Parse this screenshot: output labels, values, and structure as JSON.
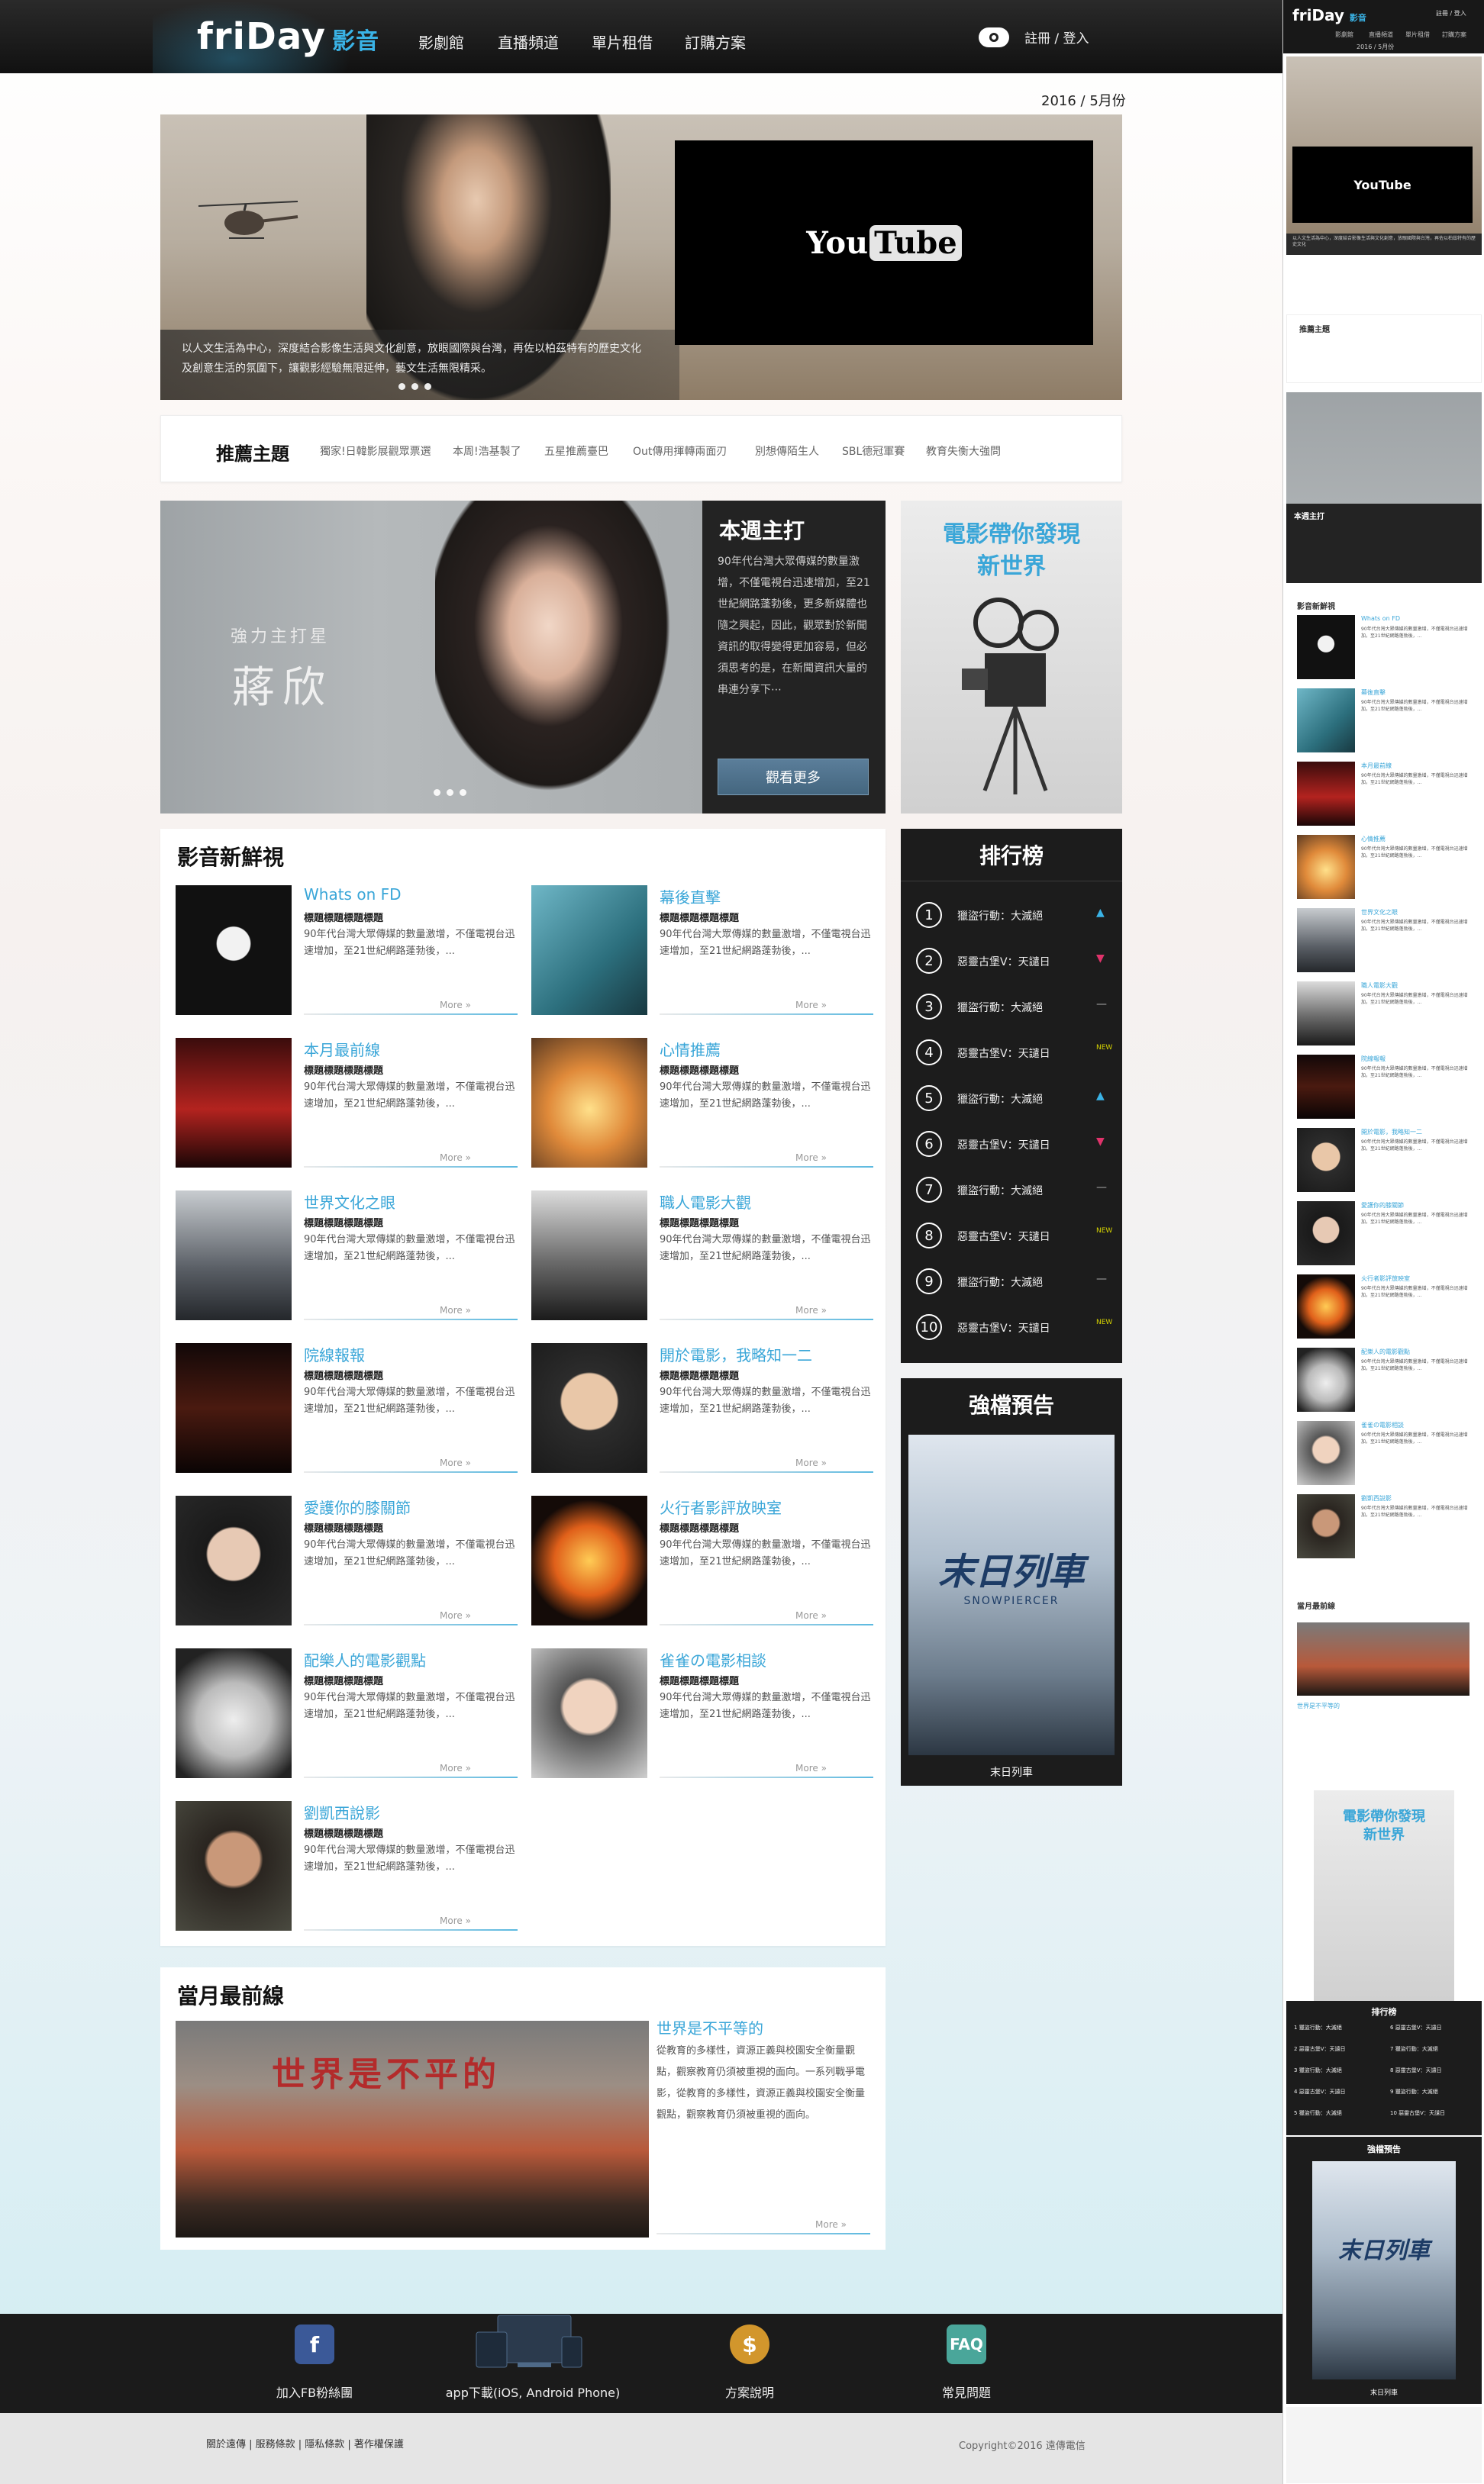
{
  "header": {
    "logo": "friDay",
    "logo_sub": "影音",
    "nav": [
      "影劇館",
      "直播頻道",
      "單片租借",
      "訂購方案"
    ],
    "register": "註冊",
    "slash": "/",
    "login": "登入"
  },
  "date": "2016 / 5月份",
  "hero": {
    "caption_line1": "以人文生活為中心，深度結合影像生活與文化創意，放眼國際與台灣，再佐以柏茲特有的歷史文化",
    "caption_line2": "及創意生活的氛圍下，讓觀影經驗無限延伸，藝文生活無限精采。",
    "video_logo_a": "You",
    "video_logo_b": "Tube"
  },
  "topics": {
    "title": "推薦主題",
    "items": [
      "獨家!日韓影展觀眾票選",
      "本周!浩基製了",
      "五星推薦臺巴",
      "Out傳用揮轉兩面刃",
      "別想傳陌生人",
      "SBL德冠軍賽",
      "教育失衡大強問"
    ]
  },
  "feature": {
    "tagline": "強力主打星",
    "name": "蔣欣"
  },
  "weekly": {
    "title": "本週主打",
    "body": "90年代台灣大眾傳媒的數量激增，不僅電視台迅速增加，至21世紀網路蓬勃後，更多新媒體也隨之興起，因此，觀眾對於新聞資訊的取得變得更加容易，但必須思考的是，在新聞資訊大量的串連分享下⋯",
    "button": "觀看更多"
  },
  "movie_promo": {
    "line1": "電影帶你發現",
    "line2": "新世界"
  },
  "news": {
    "title": "影音新鮮視",
    "items": [
      {
        "title": "Whats on FD",
        "subtitle": "標題標題標題標題",
        "desc": "90年代台灣大眾傳媒的數量激增，不僅電視台迅速增加，至21世紀網路蓬勃後，...",
        "more": "More »"
      },
      {
        "title": "幕後直擊",
        "subtitle": "標題標題標題標題",
        "desc": "90年代台灣大眾傳媒的數量激增，不僅電視台迅速增加，至21世紀網路蓬勃後，...",
        "more": "More »"
      },
      {
        "title": "本月最前線",
        "subtitle": "標題標題標題標題",
        "desc": "90年代台灣大眾傳媒的數量激增，不僅電視台迅速增加，至21世紀網路蓬勃後，...",
        "more": "More »"
      },
      {
        "title": "心情推薦",
        "subtitle": "標題標題標題標題",
        "desc": "90年代台灣大眾傳媒的數量激增，不僅電視台迅速增加，至21世紀網路蓬勃後，...",
        "more": "More »"
      },
      {
        "title": "世界文化之眼",
        "subtitle": "標題標題標題標題",
        "desc": "90年代台灣大眾傳媒的數量激增，不僅電視台迅速增加，至21世紀網路蓬勃後，...",
        "more": "More »"
      },
      {
        "title": "職人電影大觀",
        "subtitle": "標題標題標題標題",
        "desc": "90年代台灣大眾傳媒的數量激增，不僅電視台迅速增加，至21世紀網路蓬勃後，...",
        "more": "More »"
      },
      {
        "title": "院線報報",
        "subtitle": "標題標題標題標題",
        "desc": "90年代台灣大眾傳媒的數量激增，不僅電視台迅速增加，至21世紀網路蓬勃後，...",
        "more": "More »"
      },
      {
        "title": "開於電影，我略知一二",
        "subtitle": "標題標題標題標題",
        "desc": "90年代台灣大眾傳媒的數量激增，不僅電視台迅速增加，至21世紀網路蓬勃後，...",
        "more": "More »"
      },
      {
        "title": "愛護你的膝關節",
        "subtitle": "標題標題標題標題",
        "desc": "90年代台灣大眾傳媒的數量激增，不僅電視台迅速增加，至21世紀網路蓬勃後，...",
        "more": "More »"
      },
      {
        "title": "火行者影評放映室",
        "subtitle": "標題標題標題標題",
        "desc": "90年代台灣大眾傳媒的數量激增，不僅電視台迅速增加，至21世紀網路蓬勃後，...",
        "more": "More »"
      },
      {
        "title": "配樂人的電影觀點",
        "subtitle": "標題標題標題標題",
        "desc": "90年代台灣大眾傳媒的數量激增，不僅電視台迅速增加，至21世紀網路蓬勃後，...",
        "more": "More »"
      },
      {
        "title": "雀雀の電影相談",
        "subtitle": "標題標題標題標題",
        "desc": "90年代台灣大眾傳媒的數量激增，不僅電視台迅速增加，至21世紀網路蓬勃後，...",
        "more": "More »"
      },
      {
        "title": "劉凱西說影",
        "subtitle": "標題標題標題標題",
        "desc": "90年代台灣大眾傳媒的數量激增，不僅電視台迅速增加，至21世紀網路蓬勃後，...",
        "more": "More »"
      }
    ]
  },
  "ranking": {
    "title": "排行榜",
    "rows": [
      {
        "n": "1",
        "title": "獵盜行動：大滅絕",
        "trend": "▲"
      },
      {
        "n": "2",
        "title": "惡靈古堡V：天譴日",
        "trend": "▼"
      },
      {
        "n": "3",
        "title": "獵盜行動：大滅絕",
        "trend": "—"
      },
      {
        "n": "4",
        "title": "惡靈古堡V：天譴日",
        "trend": "NEW"
      },
      {
        "n": "5",
        "title": "獵盜行動：大滅絕",
        "trend": "▲"
      },
      {
        "n": "6",
        "title": "惡靈古堡V：天譴日",
        "trend": "▼"
      },
      {
        "n": "7",
        "title": "獵盜行動：大滅絕",
        "trend": "—"
      },
      {
        "n": "8",
        "title": "惡靈古堡V：天譴日",
        "trend": "NEW"
      },
      {
        "n": "9",
        "title": "獵盜行動：大滅絕",
        "trend": "—"
      },
      {
        "n": "10",
        "title": "惡靈古堡V：天譴日",
        "trend": "NEW"
      }
    ],
    "colors": {
      "up": "#3ab3e6",
      "down": "#e0336b",
      "new": "#d7d400"
    }
  },
  "trailer": {
    "title": "強檔預告",
    "poster_title": "末日列車",
    "poster_sub": "SNOWPIERCER",
    "caption": "末日列車"
  },
  "front": {
    "title": "當月最前線",
    "img_text": "世界是不平的",
    "item_title": "世界是不平等的",
    "desc": "從教育的多樣性，資源正義與校園安全衡量觀點，觀察教育仍須被重視的面向。一系列戰爭電影，從教育的多樣性，資源正義與校園安全衡量觀點，觀察教育仍須被重視的面向。",
    "more": "More »"
  },
  "footer": {
    "items": [
      {
        "label": "加入FB粉絲團",
        "icon": "facebook-icon",
        "glyph": "f"
      },
      {
        "label": "app下載(iOS, Android Phone)",
        "icon": "devices-icon",
        "glyph": ""
      },
      {
        "label": "方案說明",
        "icon": "dollar-icon",
        "glyph": "$"
      },
      {
        "label": "常見問題",
        "icon": "faq-icon",
        "glyph": "FAQ"
      }
    ],
    "links": "關於遠傳 | 服務條款 | 隱私條款 | 著作權保護",
    "copyright": "Copyright©2016 遠傳電信"
  },
  "mobile": {
    "logo": "friDay",
    "logo_sub": "影音",
    "login": "註冊 / 登入",
    "nav": [
      "影劇館",
      "直播頻道",
      "單片租借",
      "訂購方案"
    ],
    "date": "2016 / 5月份",
    "video": "YouTube",
    "topics_title": "推薦主題",
    "weekly_title": "本週主打",
    "news_title": "影音新鮮視",
    "front_title": "當月最前線",
    "front_item": "世界是不平等的",
    "promo1": "電影帶你發現",
    "promo2": "新世界",
    "rank_title": "排行榜",
    "trailer_title": "強檔預告",
    "poster_title": "末日列車",
    "caption": "末日列車"
  }
}
